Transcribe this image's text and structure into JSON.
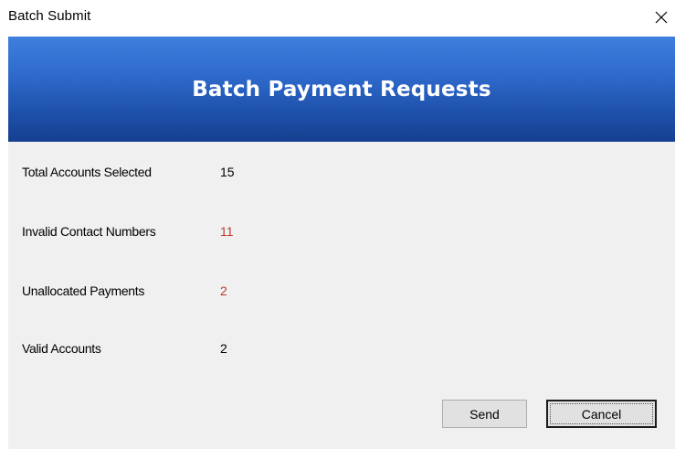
{
  "window": {
    "title": "Batch Submit",
    "close_icon": "close-icon"
  },
  "banner": {
    "title": "Batch Payment Requests",
    "gradient_top": "#3f7fdd",
    "gradient_bottom": "#163f8f"
  },
  "summary": {
    "rows": [
      {
        "label": "Total Accounts Selected",
        "value": "15",
        "highlight": false
      },
      {
        "label": "Invalid Contact Numbers",
        "value": "11",
        "highlight": true
      },
      {
        "label": "Unallocated Payments",
        "value": "2",
        "highlight": true
      },
      {
        "label": "Valid Accounts",
        "value": "2",
        "highlight": false
      }
    ],
    "highlight_color": "#c0392b"
  },
  "buttons": {
    "send_label": "Send",
    "cancel_label": "Cancel"
  }
}
